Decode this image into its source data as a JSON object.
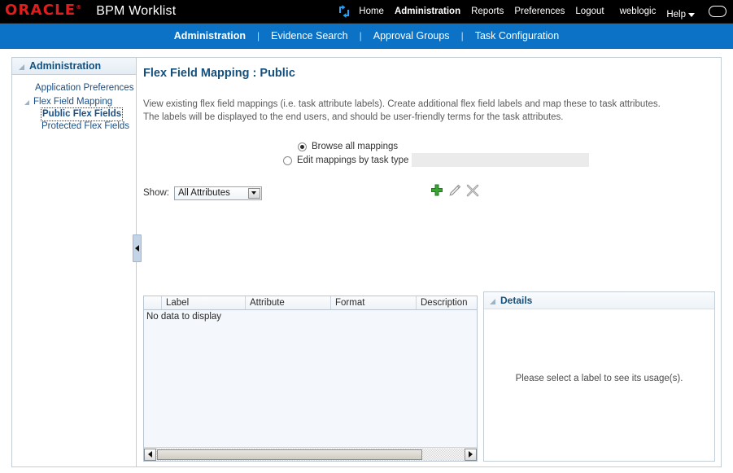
{
  "header": {
    "logo": "ORACLE",
    "logo_tm": "®",
    "app_title": "BPM Worklist",
    "refresh_icon": "refresh-icon",
    "nav": [
      {
        "label": "Home",
        "active": false
      },
      {
        "label": "Administration",
        "active": true
      },
      {
        "label": "Reports",
        "active": false
      },
      {
        "label": "Preferences",
        "active": false
      },
      {
        "label": "Logout",
        "active": false
      }
    ],
    "user": "weblogic",
    "help_label": "Help",
    "help_caret": "chevron-down-icon",
    "status_icon": "oval-icon"
  },
  "subnav": {
    "items": [
      {
        "label": "Administration",
        "active": true
      },
      {
        "label": "Evidence Search",
        "active": false
      },
      {
        "label": "Approval Groups",
        "active": false
      },
      {
        "label": "Task Configuration",
        "active": false
      }
    ],
    "separator": "|"
  },
  "sidebar": {
    "header": "Administration",
    "items": [
      {
        "label": "Application Preferences"
      }
    ],
    "group": {
      "label": "Flex Field Mapping",
      "children": [
        {
          "label": "Public Flex Fields",
          "selected": true
        },
        {
          "label": "Protected Flex Fields",
          "selected": false
        }
      ]
    }
  },
  "main": {
    "page_title": "Flex Field Mapping : Public",
    "description_line1": "View existing flex field mappings (i.e. task attribute labels). Create additional flex field labels and map these to task attributes.",
    "description_line2": "The labels will be displayed to the end users, and should be user-friendly terms for the task attributes.",
    "radios": {
      "browse_all": "Browse all mappings",
      "edit_by_task_type": "Edit mappings by task type",
      "selected": "browse_all",
      "task_type_value": ""
    },
    "show": {
      "label": "Show:",
      "selected": "All Attributes",
      "options": [
        "All Attributes"
      ]
    },
    "toolbar": {
      "add_icon": "add-plus-icon",
      "edit_icon": "edit-pencil-icon",
      "delete_icon": "delete-x-icon"
    },
    "table": {
      "columns": [
        "",
        "Label",
        "Attribute",
        "Format",
        "Description"
      ],
      "rows": [],
      "empty_message": "No data to display",
      "scroll_left_icon": "scroll-left-arrow-icon",
      "scroll_right_icon": "scroll-right-arrow-icon"
    },
    "details": {
      "title": "Details",
      "empty_message": "Please select a label to see its usage(s)."
    },
    "splitter_icon": "collapse-left-arrow-icon"
  },
  "colors": {
    "header_bg": "#000000",
    "subnav_bg": "#0c72c6",
    "oracle_red": "#e01d1d",
    "title_blue": "#14507d",
    "link_blue": "#1a4f86",
    "add_green": "#3aa434"
  }
}
